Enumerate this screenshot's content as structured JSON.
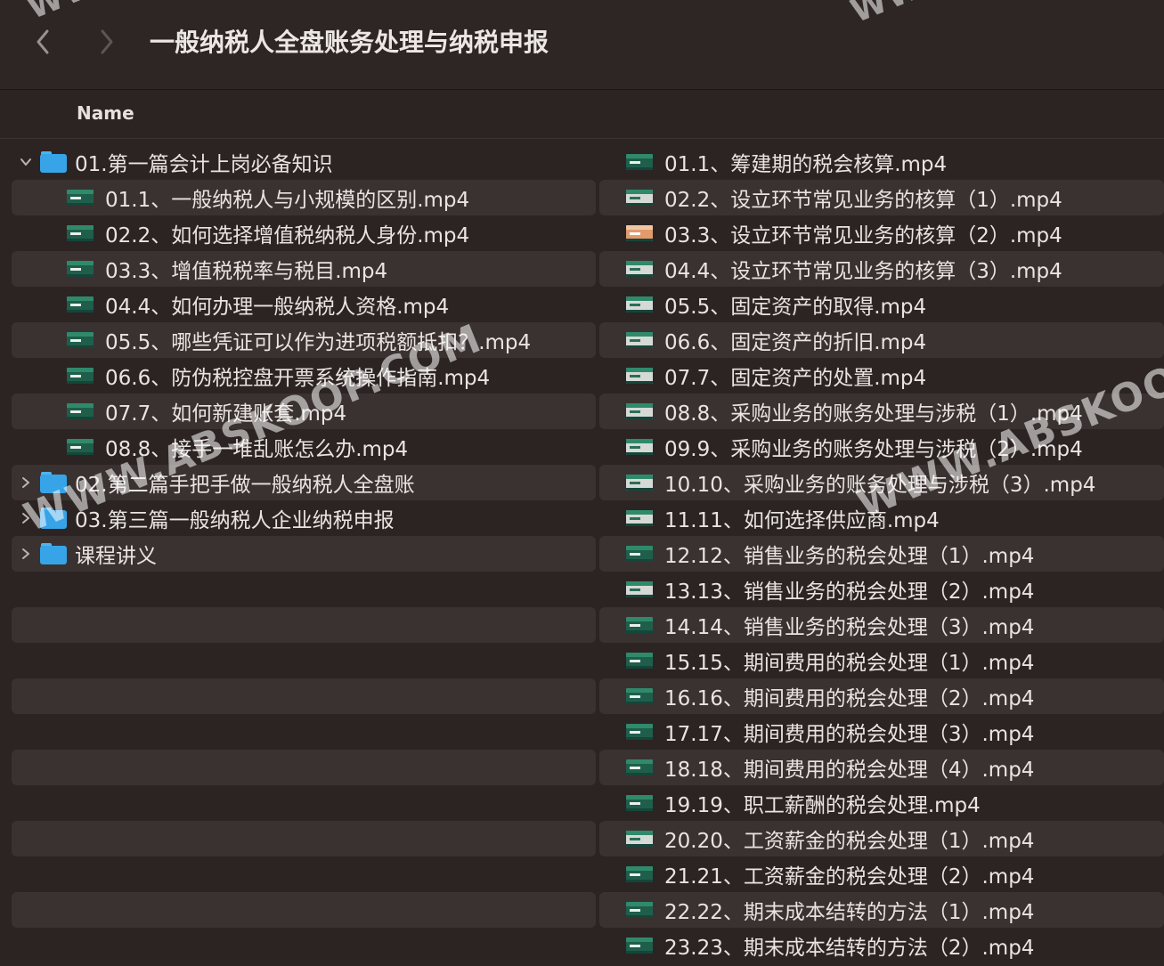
{
  "window": {
    "title": "一般纳税人全盘账务处理与纳税申报"
  },
  "column_header": {
    "name": "Name"
  },
  "left_rows": [
    {
      "kind": "folder",
      "expanded": true,
      "label": "01.第一篇会计上岗必备知识"
    },
    {
      "kind": "file",
      "icon": "video-thumbnail-icon",
      "label": "01.1、一般纳税人与小规模的区别.mp4"
    },
    {
      "kind": "file",
      "icon": "video-thumbnail-icon",
      "label": "02.2、如何选择增值税纳税人身份.mp4"
    },
    {
      "kind": "file",
      "icon": "video-thumbnail-icon",
      "label": "03.3、增值税税率与税目.mp4"
    },
    {
      "kind": "file",
      "icon": "video-thumbnail-icon",
      "label": "04.4、如何办理一般纳税人资格.mp4"
    },
    {
      "kind": "file",
      "icon": "video-thumbnail-icon",
      "label": "05.5、哪些凭证可以作为进项税额抵扣？.mp4"
    },
    {
      "kind": "file",
      "icon": "video-thumbnail-icon",
      "label": "06.6、防伪税控盘开票系统操作指南.mp4"
    },
    {
      "kind": "file",
      "icon": "video-thumbnail-icon",
      "label": "07.7、如何新建账套.mp4"
    },
    {
      "kind": "file",
      "icon": "video-thumbnail-icon",
      "label": "08.8、接手一堆乱账怎么办.mp4"
    },
    {
      "kind": "folder",
      "expanded": false,
      "label": "02.第二篇手把手做一般纳税人全盘账"
    },
    {
      "kind": "folder",
      "expanded": false,
      "label": "03.第三篇一般纳税人企业纳税申报"
    },
    {
      "kind": "folder",
      "expanded": false,
      "label": "课程讲义"
    }
  ],
  "right_rows": [
    {
      "icon": "video-thumbnail-icon",
      "label": "01.1、筹建期的税会核算.mp4"
    },
    {
      "icon": "video-thumbnail-icon",
      "label": "02.2、设立环节常见业务的核算（1）.mp4"
    },
    {
      "icon": "video-thumbnail-icon",
      "label": "03.3、设立环节常见业务的核算（2）.mp4"
    },
    {
      "icon": "video-thumbnail-icon",
      "label": "04.4、设立环节常见业务的核算（3）.mp4"
    },
    {
      "icon": "video-thumbnail-icon",
      "label": "05.5、固定资产的取得.mp4"
    },
    {
      "icon": "video-thumbnail-icon",
      "label": "06.6、固定资产的折旧.mp4"
    },
    {
      "icon": "video-thumbnail-icon",
      "label": "07.7、固定资产的处置.mp4"
    },
    {
      "icon": "video-thumbnail-icon",
      "label": "08.8、采购业务的账务处理与涉税（1）.mp4"
    },
    {
      "icon": "video-thumbnail-icon",
      "label": "09.9、采购业务的账务处理与涉税（2）.mp4"
    },
    {
      "icon": "video-thumbnail-icon",
      "label": "10.10、采购业务的账务处理与涉税（3）.mp4"
    },
    {
      "icon": "video-thumbnail-icon",
      "label": "11.11、如何选择供应商.mp4"
    },
    {
      "icon": "video-thumbnail-icon",
      "label": "12.12、销售业务的税会处理（1）.mp4"
    },
    {
      "icon": "video-thumbnail-icon",
      "label": "13.13、销售业务的税会处理（2）.mp4"
    },
    {
      "icon": "video-thumbnail-icon",
      "label": "14.14、销售业务的税会处理（3）.mp4"
    },
    {
      "icon": "video-thumbnail-icon",
      "label": "15.15、期间费用的税会处理（1）.mp4"
    },
    {
      "icon": "video-thumbnail-icon",
      "label": "16.16、期间费用的税会处理（2）.mp4"
    },
    {
      "icon": "video-thumbnail-icon",
      "label": "17.17、期间费用的税会处理（3）.mp4"
    },
    {
      "icon": "video-thumbnail-icon",
      "label": "18.18、期间费用的税会处理（4）.mp4"
    },
    {
      "icon": "video-thumbnail-icon",
      "label": "19.19、职工薪酬的税会处理.mp4"
    },
    {
      "icon": "video-thumbnail-icon",
      "label": "20.20、工资薪金的税会处理（1）.mp4"
    },
    {
      "icon": "video-thumbnail-icon",
      "label": "21.21、工资薪金的税会处理（2）.mp4"
    },
    {
      "icon": "video-thumbnail-icon",
      "label": "22.22、期末成本结转的方法（1）.mp4"
    },
    {
      "icon": "video-thumbnail-icon",
      "label": "23.23、期末成本结转的方法（2）.mp4"
    }
  ],
  "watermark": {
    "text_main": "WWW.ABSKOOP.COM",
    "text_top": "WWW"
  },
  "colors": {
    "background": "#2b2422",
    "row_alt": "#3a3230",
    "folder": "#38a4e8",
    "text": "#e9e3e1"
  }
}
